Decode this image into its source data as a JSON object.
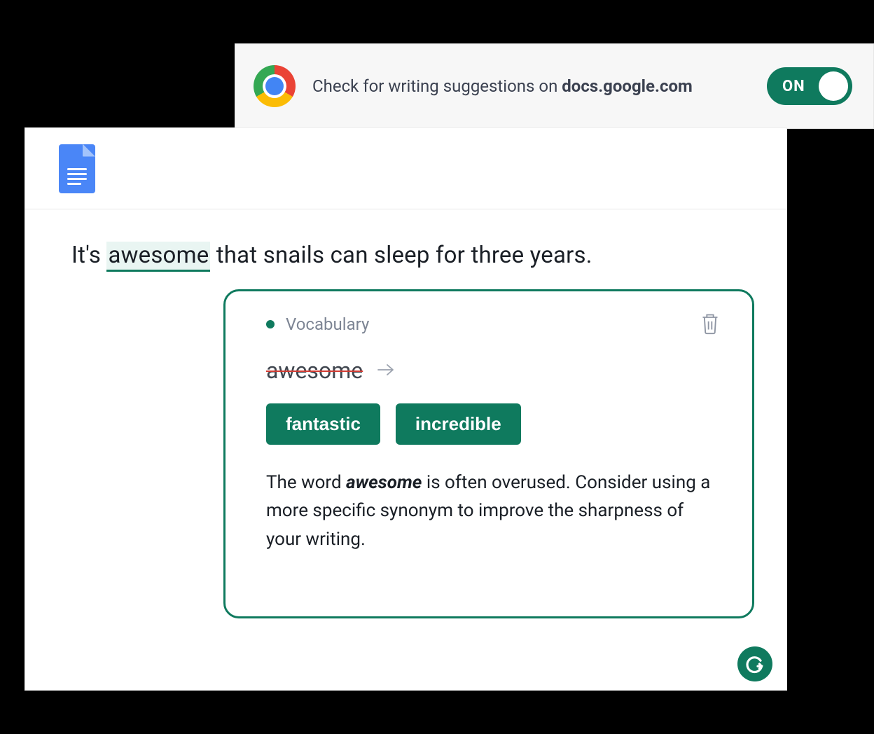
{
  "extension": {
    "text_prefix": "Check for writing suggestions on ",
    "domain": "docs.google.com",
    "toggle_state": "ON"
  },
  "sentence": {
    "pre": "It's ",
    "flagged": "awesome",
    "post": " that snails can sleep for three years."
  },
  "popup": {
    "category": "Vocabulary",
    "strike_word": "awesome",
    "suggestions": [
      "fantastic",
      "incredible"
    ],
    "explanation_pre": "The word ",
    "explanation_em": "awesome",
    "explanation_post": " is often overused. Consider using a more specific synonym to improve the sharpness of your writing."
  }
}
